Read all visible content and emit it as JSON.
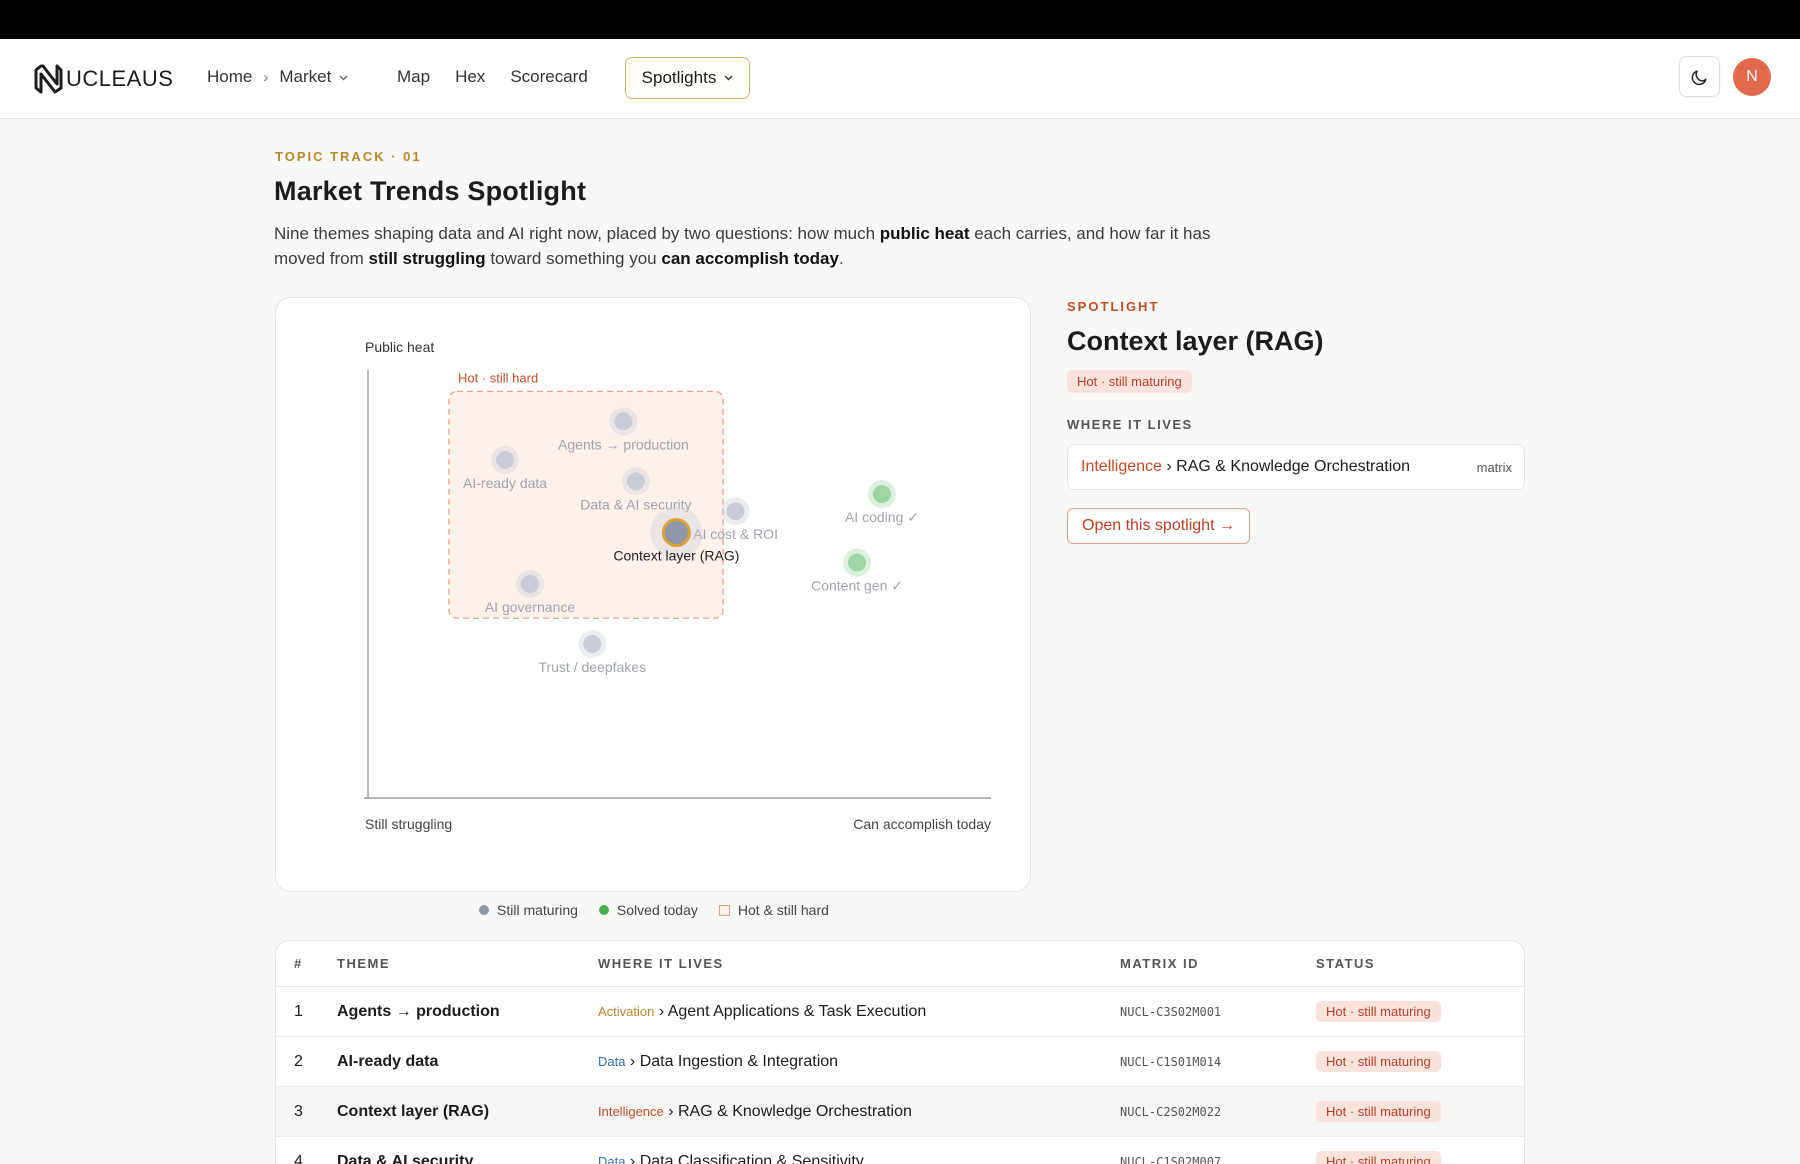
{
  "brand": {
    "logo_text": "UCLEAUS"
  },
  "nav": {
    "crumbs": [
      "Home",
      "Market"
    ],
    "links": [
      "Map",
      "Hex",
      "Scorecard"
    ],
    "spotlights_label": "Spotlights",
    "avatar_initial": "N"
  },
  "page": {
    "eyebrow": "TOPIC TRACK · 01",
    "title": "Market Trends Spotlight",
    "intro": {
      "p1": "Nine themes shaping data and AI right now, placed by two questions: how much ",
      "b1": "public heat",
      "p2": " each carries, and how far it has moved from ",
      "b2": "still struggling",
      "p3": " toward something you ",
      "b3": "can accomplish today",
      "p4": "."
    }
  },
  "chart_data": {
    "type": "scatter",
    "ylabel": "Public heat",
    "x_start_label": "Still struggling",
    "x_end_label": "Can accomplish today",
    "region_label": "Hot · still hard",
    "region": {
      "x": [
        0.13,
        0.57
      ],
      "y": [
        0.42,
        0.95
      ]
    },
    "points": [
      {
        "name": "Agents → production",
        "x": 0.41,
        "y": 0.88,
        "status": "maturing",
        "label_pos": "below"
      },
      {
        "name": "AI-ready data",
        "x": 0.22,
        "y": 0.79,
        "status": "maturing",
        "label_pos": "below"
      },
      {
        "name": "Data & AI security",
        "x": 0.43,
        "y": 0.74,
        "status": "maturing",
        "label_pos": "below"
      },
      {
        "name": "AI cost & ROI",
        "x": 0.59,
        "y": 0.67,
        "status": "maturing",
        "label_pos": "below"
      },
      {
        "name": "Context layer (RAG)",
        "x": 0.495,
        "y": 0.62,
        "status": "maturing",
        "label_pos": "below",
        "selected": true
      },
      {
        "name": "AI coding ✓",
        "x": 0.825,
        "y": 0.71,
        "status": "solved",
        "label_pos": "below"
      },
      {
        "name": "Content gen ✓",
        "x": 0.785,
        "y": 0.55,
        "status": "solved",
        "label_pos": "below"
      },
      {
        "name": "AI governance",
        "x": 0.26,
        "y": 0.5,
        "status": "maturing",
        "label_pos": "below"
      },
      {
        "name": "Trust / deepfakes",
        "x": 0.36,
        "y": 0.36,
        "status": "maturing",
        "label_pos": "below"
      }
    ],
    "colors": {
      "maturing": "#c9ccd6",
      "solved": "#9fd4a4",
      "selected_fill": "#8f98a8",
      "selected_ring": "#d9a33a",
      "region_fill": "#fdf1ec",
      "region_stroke": "#e8a58e",
      "region_label": "#c04d2a"
    }
  },
  "legend": {
    "maturing": "Still maturing",
    "solved": "Solved today",
    "region": "Hot & still hard",
    "colors": {
      "maturing": "#8e95a5",
      "solved": "#4caf50"
    }
  },
  "spotlight": {
    "eyebrow": "SPOTLIGHT",
    "title": "Context layer (RAG)",
    "badge": "Hot · still maturing",
    "where_label": "WHERE IT LIVES",
    "tier": "Intelligence",
    "path": " › RAG & Knowledge Orchestration",
    "tag": "matrix",
    "open_label": "Open this spotlight →"
  },
  "table": {
    "headers": [
      "#",
      "THEME",
      "WHERE IT LIVES",
      "MATRIX ID",
      "STATUS"
    ],
    "rows": [
      {
        "num": "1",
        "theme": "Agents → production",
        "tier": "Activation",
        "path": " › Agent Applications & Task Execution",
        "id": "NUCL-C3S02M001",
        "status": "Hot · still maturing"
      },
      {
        "num": "2",
        "theme": "AI-ready data",
        "tier": "Data",
        "path": " › Data Ingestion & Integration",
        "id": "NUCL-C1S01M014",
        "status": "Hot · still maturing"
      },
      {
        "num": "3",
        "theme": "Context layer (RAG)",
        "tier": "Intelligence",
        "path": " › RAG & Knowledge Orchestration",
        "id": "NUCL-C2S02M022",
        "status": "Hot · still maturing"
      },
      {
        "num": "4",
        "theme": "Data & AI security",
        "tier": "Data",
        "path": " › Data Classification & Sensitivity",
        "id": "NUCL-C1S02M007",
        "status": "Hot · still maturing"
      }
    ]
  }
}
